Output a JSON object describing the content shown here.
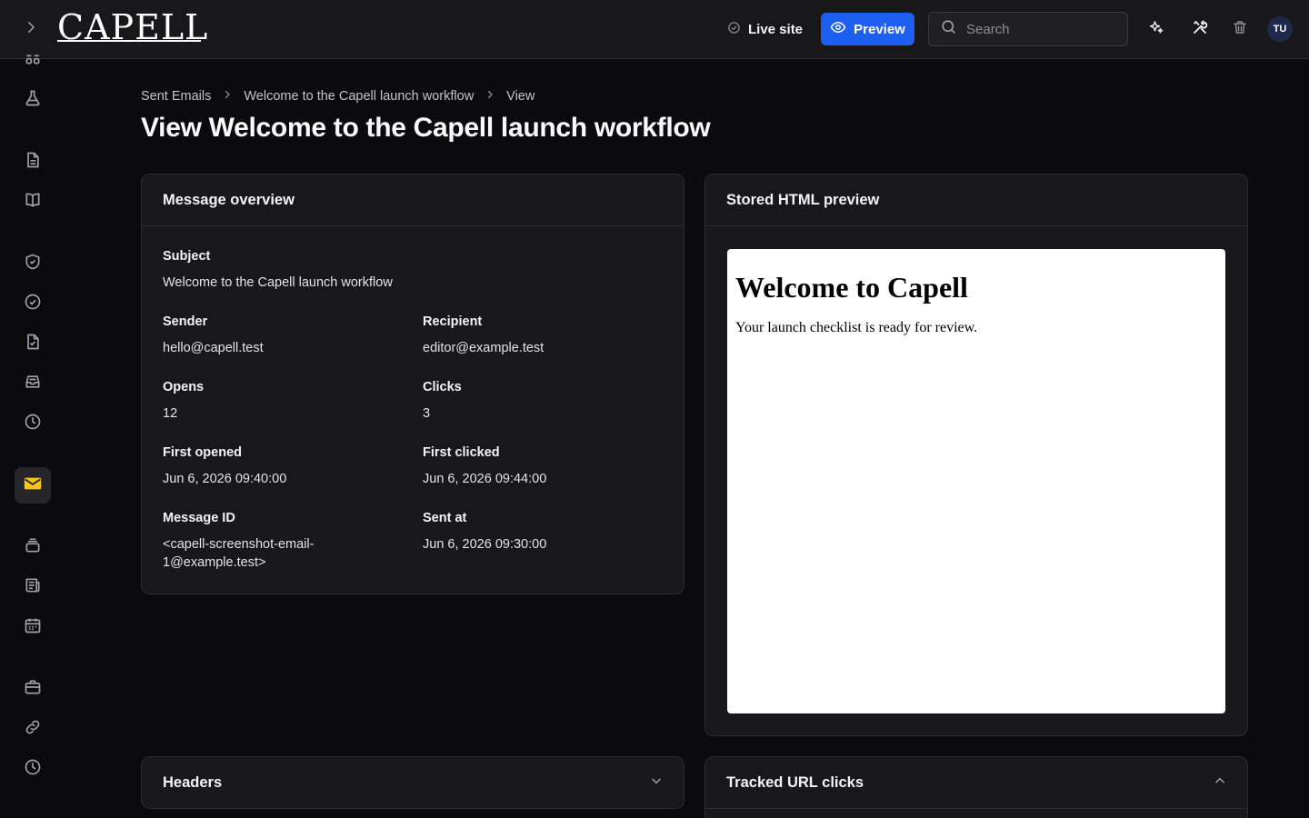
{
  "topbar": {
    "logo": "CAPELL",
    "live_site_label": "Live site",
    "preview_label": "Preview",
    "search_placeholder": "Search",
    "avatar_initials": "TU",
    "icons": [
      "sparkle-icon",
      "tools-icon",
      "trash-icon"
    ]
  },
  "sidebar": {
    "items": [
      "apps-icon",
      "flask-icon",
      "document-icon",
      "book-icon",
      "shield-check-icon",
      "check-circle-icon",
      "file-check-icon",
      "inbox-icon",
      "clock-icon",
      "mail-icon",
      "stack-icon",
      "newspaper-icon",
      "calendar-icon",
      "briefcase-icon",
      "link-icon",
      "history-icon"
    ],
    "active": "mail-icon",
    "active_color": "#f5c518"
  },
  "breadcrumb": {
    "items": [
      "Sent Emails",
      "Welcome to the Capell launch workflow",
      "View"
    ]
  },
  "page_title": "View Welcome to the Capell launch workflow",
  "overview": {
    "title": "Message overview",
    "subject_label": "Subject",
    "subject": "Welcome to the Capell launch workflow",
    "sender_label": "Sender",
    "sender": "hello@capell.test",
    "recipient_label": "Recipient",
    "recipient": "editor@example.test",
    "opens_label": "Opens",
    "opens": "12",
    "clicks_label": "Clicks",
    "clicks": "3",
    "first_opened_label": "First opened",
    "first_opened": "Jun 6, 2026 09:40:00",
    "first_clicked_label": "First clicked",
    "first_clicked": "Jun 6, 2026 09:44:00",
    "message_id_label": "Message ID",
    "message_id": "<capell-screenshot-email-1@example.test>",
    "sent_at_label": "Sent at",
    "sent_at": "Jun 6, 2026 09:30:00"
  },
  "preview": {
    "title": "Stored HTML preview",
    "heading": "Welcome to Capell",
    "body": "Your launch checklist is ready for review."
  },
  "headers_section": {
    "title": "Headers",
    "state": "collapsed"
  },
  "tracked_section": {
    "title": "Tracked URL clicks",
    "state": "expanded"
  },
  "colors": {
    "accent": "#1d5ff0",
    "background": "#0b0b0d",
    "card": "#18181b"
  }
}
